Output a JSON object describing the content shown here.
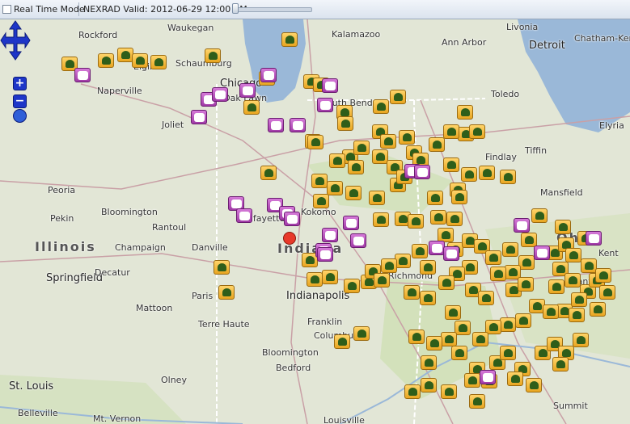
{
  "toolbar": {
    "realtime_label": "Real Time Mode",
    "status_text": "NEXRAD Valid: 2012-06-29 12:00 AM"
  },
  "map": {
    "states": [
      "Illinois",
      "Indiana",
      "Ohio"
    ],
    "cities": [
      "Rockford",
      "Waukegan",
      "Kalamazoo",
      "Ann Arbor",
      "Livonia",
      "Detroit",
      "Chatham-Kent",
      "Elgin",
      "Schaumburg",
      "Naperville",
      "Chicago",
      "Oak Lawn",
      "Joliet",
      "South Bend",
      "Toledo",
      "Findlay",
      "Tiffin",
      "Peoria",
      "Pekin",
      "Bloomington",
      "Rantoul",
      "Lafayette",
      "Kokomo",
      "Champaign",
      "Danville",
      "Mansfield",
      "Springfield",
      "Decatur",
      "Paris",
      "Indianapolis",
      "Richmond",
      "Mattoon",
      "Terre Haute",
      "Franklin",
      "Columbus",
      "Bloomington",
      "Bedford",
      "Olney",
      "St. Louis",
      "Belleville",
      "Mt. Vernon",
      "Louisville",
      "Summit",
      "Elyria",
      "Kent",
      "Canton"
    ],
    "marker_colors": {
      "wind": "#f0b637",
      "hail": "#b44ab9",
      "tornado": "#e8392a"
    }
  }
}
